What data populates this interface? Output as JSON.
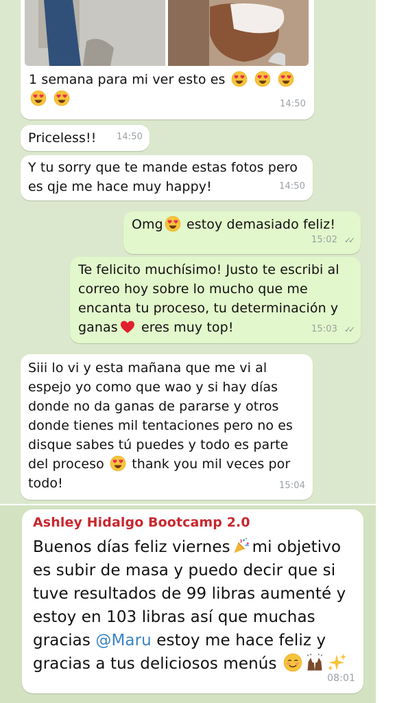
{
  "screenshot1": {
    "messages": [
      {
        "text": "1 semana para mi ver esto es",
        "time": "14:50"
      },
      {
        "text": "Priceless!!",
        "time": "14:50"
      },
      {
        "text": "Y tu sorry que te mande estas fotos pero es qje me hace muy happy!",
        "time": "14:50"
      },
      {
        "text_before": "Omg",
        "text_after": "estoy demasiado feliz!",
        "time": "15:02"
      },
      {
        "text_before": "Te felicito muchísimo! Justo te escribi al correo hoy sobre lo mucho que me encanta tu proceso, tu determinación y ganas",
        "text_after": "eres muy top!",
        "time": "15:03"
      },
      {
        "text_before": "Siii lo vi y esta mañana que me vi al espejo yo como que wao y si hay días donde no da ganas de pararse y otros donde tienes mil tentaciones pero no es disque sabes tú puedes y todo es parte del proceso",
        "text_after": "thank you mil veces por todo!",
        "time": "15:04"
      }
    ],
    "icons": {
      "heart_eyes": "heart-eyes-emoji",
      "red_heart": "red-heart-emoji",
      "read_receipt": "double-check-icon"
    }
  },
  "screenshot2": {
    "sender": "Ashley Hidalgo Bootcamp 2.0",
    "text_1": "Buenos días feliz viernes",
    "text_2": "mi objetivo es subir de masa y puedo decir que si tuve resultados de 99 libras aumenté y estoy en 103 libras así que muchas gracias",
    "mention": "@Maru",
    "text_3": "estoy me hace feliz y gracias a tus deliciosos menús",
    "time": "08:01",
    "icons": [
      "party-popper-emoji",
      "smiling-face-emoji",
      "raising-hands-emoji",
      "sparkles-emoji"
    ]
  },
  "colors": {
    "chat_background": "#dbe8cd",
    "outgoing_bubble": "#e2f7cb",
    "incoming_bubble": "#ffffff",
    "sender_name": "#c8282f",
    "mention": "#3a83c4"
  }
}
